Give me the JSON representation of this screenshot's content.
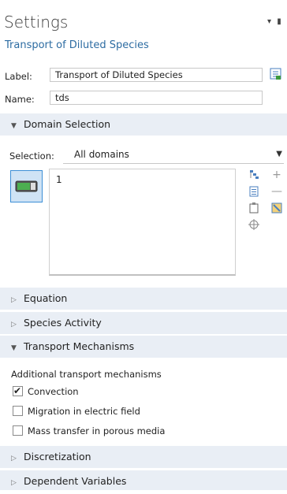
{
  "header": {
    "title": "Settings",
    "subtitle": "Transport of Diluted Species",
    "menu_glyph": "▾ ▮"
  },
  "label_field": {
    "label": "Label:",
    "value": "Transport of Diluted Species"
  },
  "name_field": {
    "label": "Name:",
    "value": "tds"
  },
  "domain_selection": {
    "header": "Domain Selection",
    "selection_label": "Selection:",
    "selection_value": "All domains",
    "list_items": [
      "1"
    ]
  },
  "sections": {
    "equation": "Equation",
    "species_activity": "Species Activity",
    "transport_mechanisms": "Transport Mechanisms",
    "discretization": "Discretization",
    "dependent_variables": "Dependent Variables"
  },
  "transport": {
    "heading": "Additional transport mechanisms",
    "options": [
      {
        "label": "Convection",
        "checked": true
      },
      {
        "label": "Migration in electric field",
        "checked": false
      },
      {
        "label": "Mass transfer in porous media",
        "checked": false
      }
    ]
  },
  "icons": {
    "list_icon": "list-icon",
    "toggle_icon": "active-toggle-icon",
    "plus_icon": "plus-icon",
    "minus_icon": "minus-icon",
    "paste_icon": "paste-icon",
    "copy_icon": "copy-icon",
    "clear_icon": "clear-selection-icon",
    "zoom_icon": "zoom-to-selection-icon",
    "paint_icon": "color-selection-icon"
  },
  "colors": {
    "section_bg": "#e9eef5",
    "subtitle": "#2d6ca2",
    "toggle_bg": "#cfe3f5",
    "toggle_border": "#3d8fd6",
    "toggle_on": "#4caf50"
  }
}
